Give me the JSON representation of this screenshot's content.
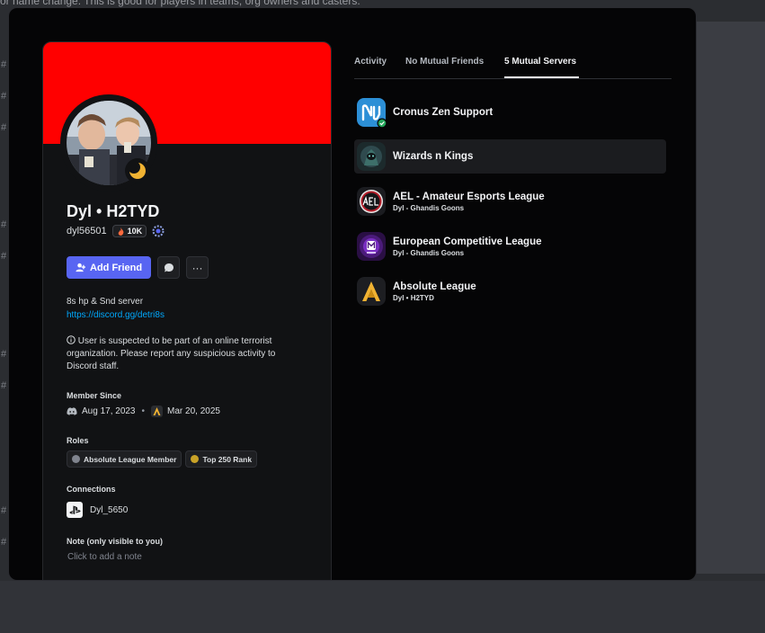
{
  "background": {
    "top_text": "or name change. This is good for players in teams, org owners and casters."
  },
  "profile": {
    "display_name": "Dyl • H2TYD",
    "username": "dyl56501",
    "badge_label": "10K",
    "actions": {
      "add_friend_label": "Add Friend",
      "more_label": "···"
    },
    "bio_line": "8s hp & Snd server",
    "bio_link": "https://discord.gg/detri8s",
    "notice_text": "User is suspected to be part of an online terrorist organization. Please report any suspicious activity to Discord staff.",
    "member_since": {
      "label": "Member Since",
      "discord_date": "Aug 17, 2023",
      "server_date": "Mar 20, 2025"
    },
    "roles": {
      "label": "Roles",
      "items": [
        {
          "name": "Absolute League Member",
          "color": "#80848e"
        },
        {
          "name": "Top 250 Rank",
          "color": "#c9a227"
        }
      ]
    },
    "connections": {
      "label": "Connections",
      "items": [
        {
          "name": "Dyl_5650",
          "icon": "playstation-icon"
        }
      ]
    },
    "note": {
      "label": "Note (only visible to you)",
      "placeholder": "Click to add a note"
    },
    "colors": {
      "banner": "#ff0000",
      "accent": "#5865f2",
      "link": "#00a8fc"
    }
  },
  "tabs": [
    {
      "label": "Activity",
      "active": false
    },
    {
      "label": "No Mutual Friends",
      "active": false
    },
    {
      "label": "5 Mutual Servers",
      "active": true
    }
  ],
  "servers": [
    {
      "name": "Cronus Zen Support",
      "nick": "",
      "icon": "cronus-zen-icon"
    },
    {
      "name": "Wizards n Kings",
      "nick": "",
      "icon": "wizards-icon"
    },
    {
      "name": "AEL - Amateur Esports League",
      "nick": "Dyl - Ghandis Goons",
      "icon": "ael-icon"
    },
    {
      "name": "European Competitive League",
      "nick": "Dyl - Ghandis Goons",
      "icon": "ecl-icon"
    },
    {
      "name": "Absolute League",
      "nick": "Dyl • H2TYD",
      "icon": "absolute-league-icon"
    }
  ]
}
